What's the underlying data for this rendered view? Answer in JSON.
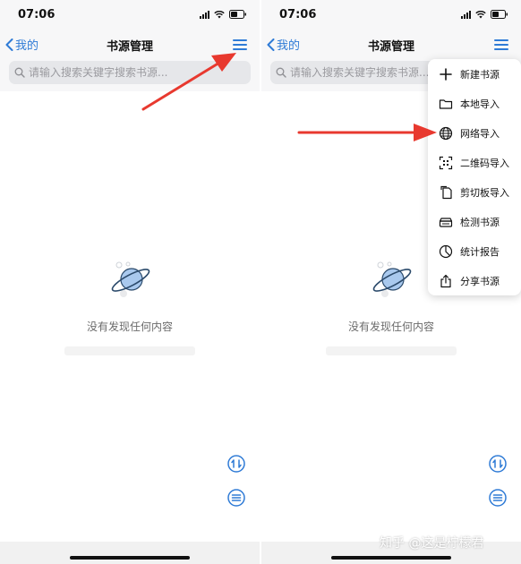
{
  "status": {
    "time": "07:06"
  },
  "nav": {
    "back_label": "我的",
    "title": "书源管理"
  },
  "search": {
    "placeholder": "请输入搜索关键字搜索书源..."
  },
  "empty_state": {
    "message": "没有发现任何内容"
  },
  "menu": {
    "items": [
      {
        "label": "新建书源",
        "icon": "plus-icon"
      },
      {
        "label": "本地导入",
        "icon": "folder-icon"
      },
      {
        "label": "网络导入",
        "icon": "globe-icon"
      },
      {
        "label": "二维码导入",
        "icon": "qr-scan-icon"
      },
      {
        "label": "剪切板导入",
        "icon": "clipboard-icon"
      },
      {
        "label": "检测书源",
        "icon": "scanner-icon"
      },
      {
        "label": "统计报告",
        "icon": "pie-chart-icon"
      },
      {
        "label": "分享书源",
        "icon": "share-icon"
      }
    ]
  },
  "watermark": "知乎 @这是柠檬君",
  "colors": {
    "accent": "#2f7bd6",
    "annotation_arrow": "#e8392f"
  }
}
